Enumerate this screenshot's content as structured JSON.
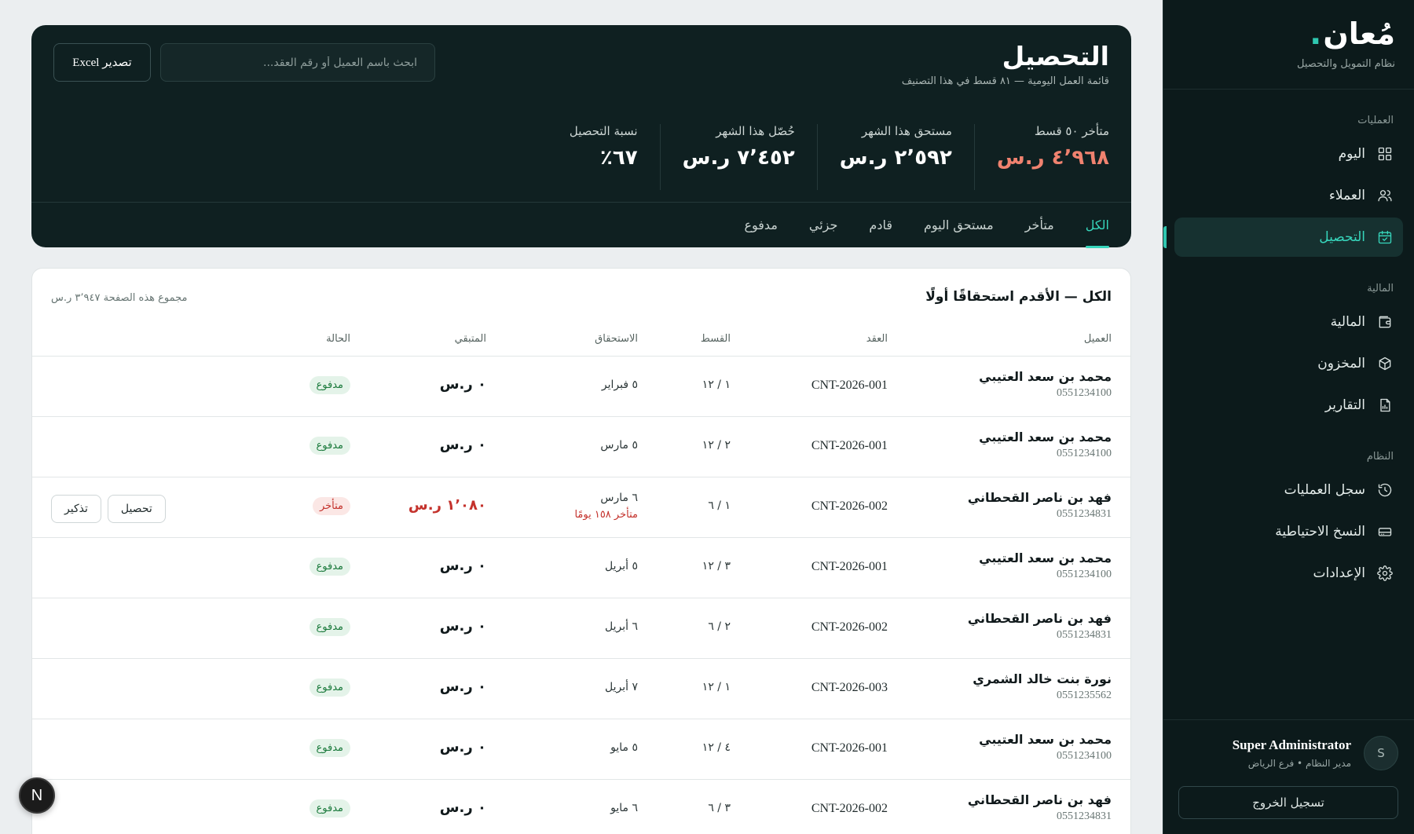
{
  "brand": {
    "logo": "مُعان",
    "subtitle": "نظام التمويل والتحصيل"
  },
  "sidebar": {
    "sections": [
      {
        "heading": "العمليات",
        "items": [
          {
            "label": "اليوم",
            "icon": "grid-icon",
            "active": false
          },
          {
            "label": "العملاء",
            "icon": "users-icon",
            "active": false
          },
          {
            "label": "التحصيل",
            "icon": "calendar-check-icon",
            "active": true
          }
        ]
      },
      {
        "heading": "المالية",
        "items": [
          {
            "label": "المالية",
            "icon": "wallet-icon",
            "active": false
          },
          {
            "label": "المخزون",
            "icon": "box-icon",
            "active": false
          },
          {
            "label": "التقارير",
            "icon": "report-icon",
            "active": false
          }
        ]
      },
      {
        "heading": "النظام",
        "items": [
          {
            "label": "سجل العمليات",
            "icon": "history-icon",
            "active": false
          },
          {
            "label": "النسخ الاحتياطية",
            "icon": "storage-icon",
            "active": false
          },
          {
            "label": "الإعدادات",
            "icon": "gear-icon",
            "active": false
          }
        ]
      }
    ]
  },
  "user": {
    "initial": "S",
    "name": "Super Administrator",
    "role": "مدير النظام • فرع الرياض",
    "logout": "تسجيل الخروج"
  },
  "header": {
    "title": "التحصيل",
    "subtitle": "قائمة العمل اليومية — ٨١ قسط في هذا التصنيف",
    "search_placeholder": "ابحث باسم العميل أو رقم العقد...",
    "export_label": "تصدير Excel",
    "stats": [
      {
        "label": "متأخر ٥٠ قسط",
        "value": "٤٬٩٦٨ ر.س",
        "overdue": true
      },
      {
        "label": "مستحق هذا الشهر",
        "value": "٢٬٥٩٢ ر.س",
        "overdue": false
      },
      {
        "label": "حُصّل هذا الشهر",
        "value": "٧٬٤٥٢ ر.س",
        "overdue": false
      },
      {
        "label": "نسبة التحصيل",
        "value": "٦٧٪",
        "overdue": false
      }
    ],
    "tabs": [
      "الكل",
      "متأخر",
      "مستحق اليوم",
      "قادم",
      "جزئي",
      "مدفوع"
    ],
    "active_tab": 0
  },
  "table": {
    "title": "الكل — الأقدم استحقاقًا أولًا",
    "page_total": "مجموع هذه الصفحة ٣٬٩٤٧ ر.س",
    "columns": {
      "client": "العميل",
      "contract": "العقد",
      "installment": "القسط",
      "due": "الاستحقاق",
      "remaining": "المتبقي",
      "status": "الحالة"
    },
    "actions": {
      "collect": "تحصيل",
      "remind": "تذكير"
    },
    "rows": [
      {
        "client": "محمد بن سعد العتيبي",
        "phone": "0551234100",
        "contract": "CNT-2026-001",
        "installment": "١ / ١٢",
        "due": "٥ فبراير",
        "due_late": "",
        "remaining": "٠ ر.س",
        "status": "مدفوع",
        "state": "paid"
      },
      {
        "client": "محمد بن سعد العتيبي",
        "phone": "0551234100",
        "contract": "CNT-2026-001",
        "installment": "٢ / ١٢",
        "due": "٥ مارس",
        "due_late": "",
        "remaining": "٠ ر.س",
        "status": "مدفوع",
        "state": "paid"
      },
      {
        "client": "فهد بن ناصر القحطاني",
        "phone": "0551234831",
        "contract": "CNT-2026-002",
        "installment": "١ / ٦",
        "due": "٦ مارس",
        "due_late": "متأخر ١٥٨ يومًا",
        "remaining": "١٬٠٨٠ ر.س",
        "status": "متأخر",
        "state": "late"
      },
      {
        "client": "محمد بن سعد العتيبي",
        "phone": "0551234100",
        "contract": "CNT-2026-001",
        "installment": "٣ / ١٢",
        "due": "٥ أبريل",
        "due_late": "",
        "remaining": "٠ ر.س",
        "status": "مدفوع",
        "state": "paid"
      },
      {
        "client": "فهد بن ناصر القحطاني",
        "phone": "0551234831",
        "contract": "CNT-2026-002",
        "installment": "٢ / ٦",
        "due": "٦ أبريل",
        "due_late": "",
        "remaining": "٠ ر.س",
        "status": "مدفوع",
        "state": "paid"
      },
      {
        "client": "نورة بنت خالد الشمري",
        "phone": "0551235562",
        "contract": "CNT-2026-003",
        "installment": "١ / ١٢",
        "due": "٧ أبريل",
        "due_late": "",
        "remaining": "٠ ر.س",
        "status": "مدفوع",
        "state": "paid"
      },
      {
        "client": "محمد بن سعد العتيبي",
        "phone": "0551234100",
        "contract": "CNT-2026-001",
        "installment": "٤ / ١٢",
        "due": "٥ مايو",
        "due_late": "",
        "remaining": "٠ ر.س",
        "status": "مدفوع",
        "state": "paid"
      },
      {
        "client": "فهد بن ناصر القحطاني",
        "phone": "0551234831",
        "contract": "CNT-2026-002",
        "installment": "٣ / ٦",
        "due": "٦ مايو",
        "due_late": "",
        "remaining": "٠ ر.س",
        "status": "مدفوع",
        "state": "paid"
      }
    ]
  },
  "dev_badge": "N",
  "colors": {
    "accent": "#37d6bc",
    "sidebar_bg": "#0c1a1b",
    "header_bg": "#0f2021",
    "overdue": "#f0826f",
    "danger": "#c4322c",
    "paid": "#1b7a3c"
  }
}
